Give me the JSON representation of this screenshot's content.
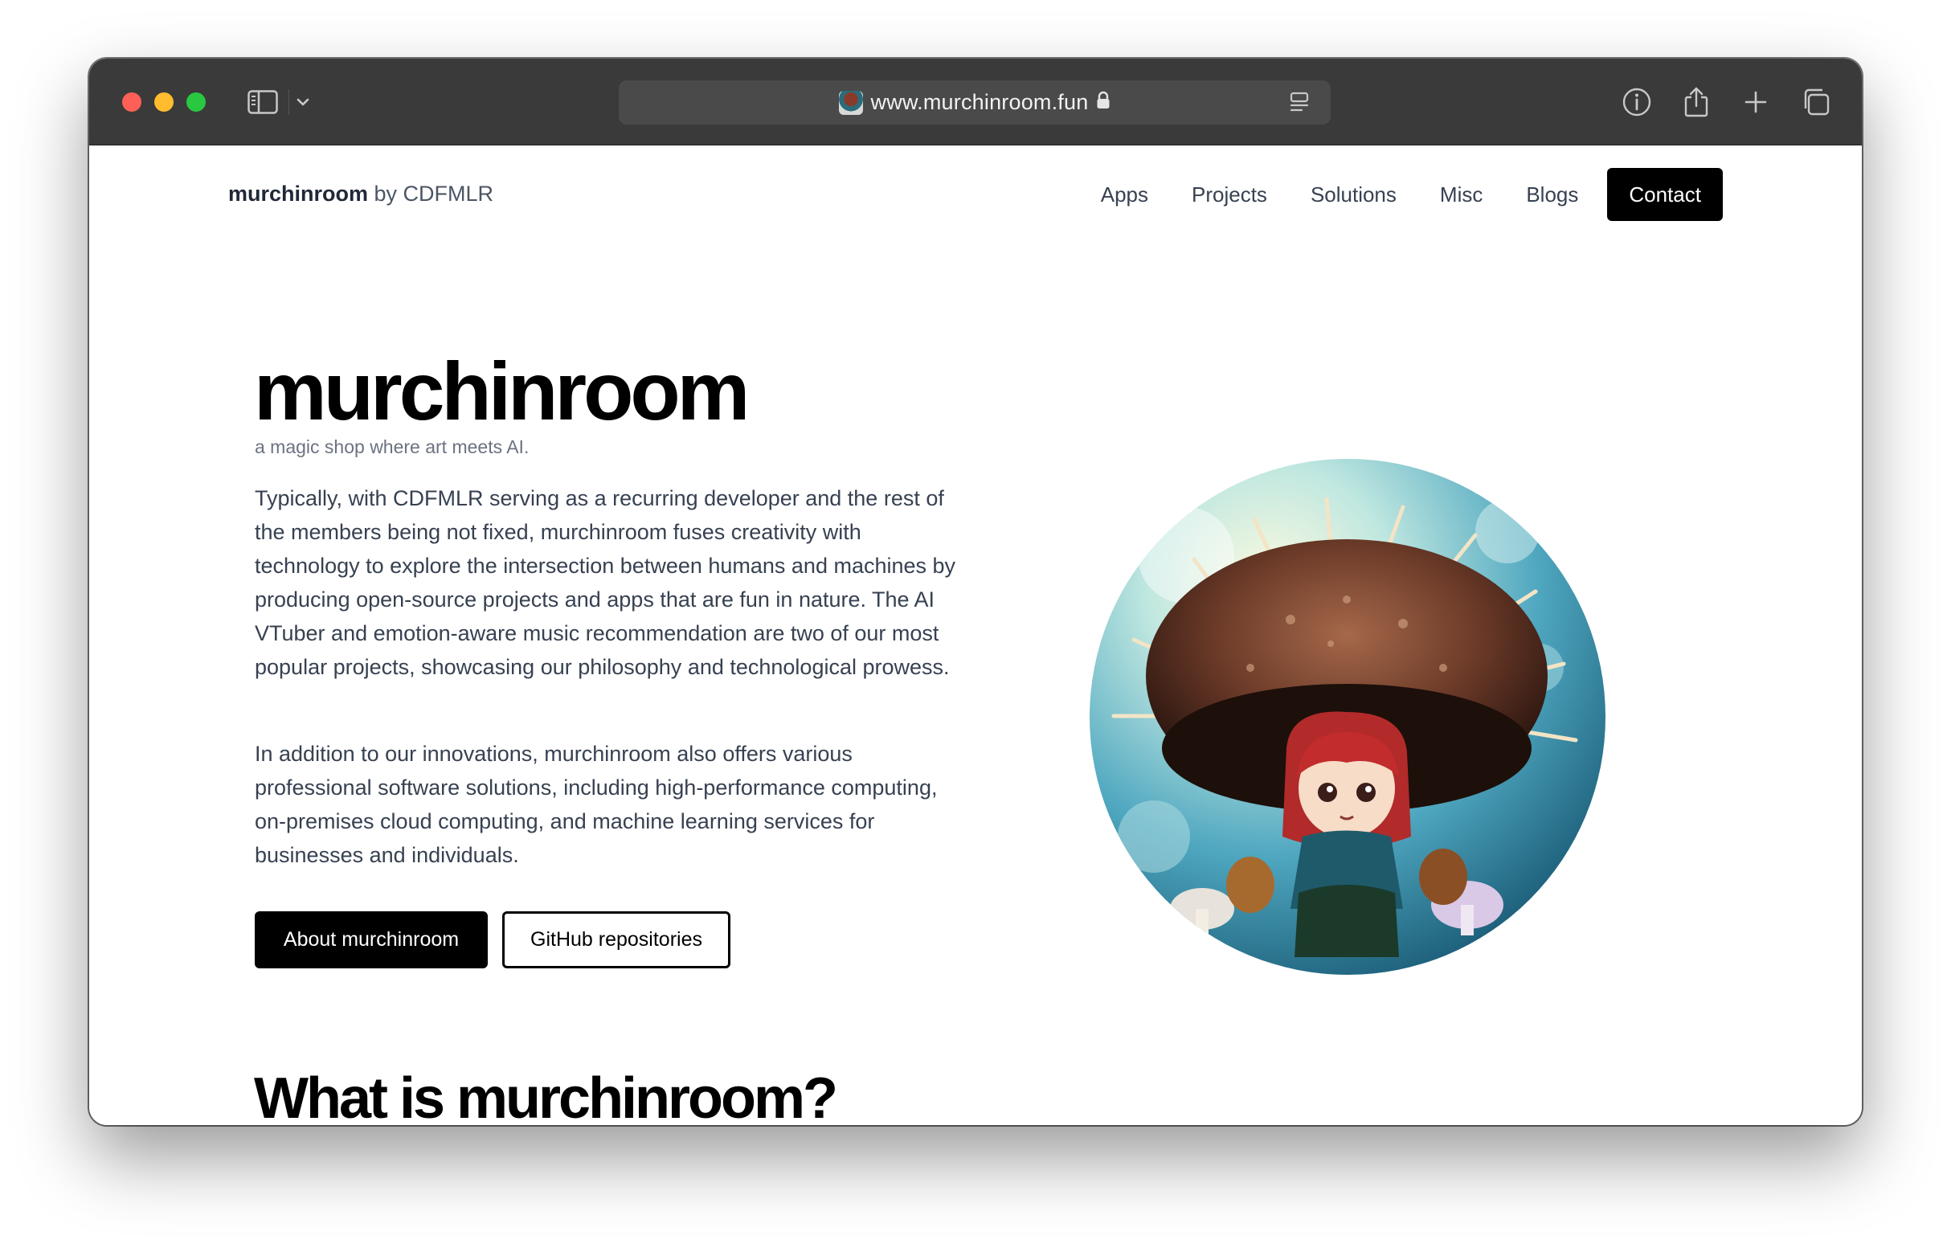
{
  "browser": {
    "url": "www.murchinroom.fun"
  },
  "site": {
    "brand_name": "murchinroom",
    "brand_suffix": "by CDFMLR",
    "nav": [
      "Apps",
      "Projects",
      "Solutions",
      "Misc",
      "Blogs"
    ],
    "contact_label": "Contact"
  },
  "hero": {
    "title": "murchinroom",
    "tagline": "a magic shop where art meets AI.",
    "para1_a": "Typically, with CDFMLR serving as a recurring developer and the rest of the members being not fixed, murchinroom fuses creativity with technology to explore the intersection between humans and machines by producing open-source projects and apps that are fun in nature. The ",
    "link_vtuber": "AI VTuber",
    "para1_b": " and ",
    "link_music": "emotion-aware music recommendation",
    "para1_c": " are two of our most popular projects, showcasing our philosophy and technological prowess.",
    "para2": "In addition to our innovations, murchinroom also offers various professional software solutions, including high-performance computing, on-premises cloud computing, and machine learning services for businesses and individuals.",
    "about_button": "About murchinroom",
    "github_button": "GitHub repositories"
  },
  "section": {
    "title": "What is murchinroom?"
  },
  "colors": {
    "titlebar": "#3a3a3a",
    "accent": "#000000",
    "text": "#374151"
  }
}
